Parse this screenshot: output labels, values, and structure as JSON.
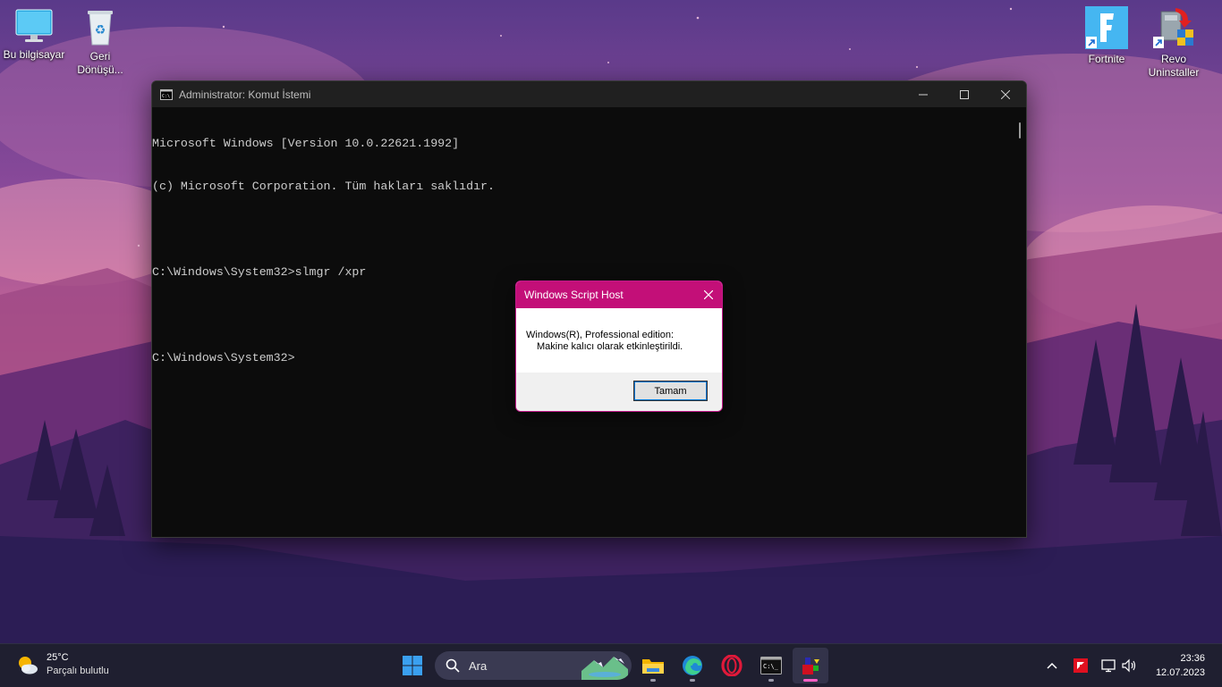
{
  "desktop": {
    "icons": [
      {
        "label": "Bu bilgisayar"
      },
      {
        "label": "Geri Dönüşü..."
      },
      {
        "label": "Fortnite"
      },
      {
        "label": "Revo Uninstaller"
      }
    ]
  },
  "cmd_window": {
    "title": "Administrator: Komut İstemi",
    "lines": [
      "Microsoft Windows [Version 10.0.22621.1992]",
      "(c) Microsoft Corporation. Tüm hakları saklıdır.",
      "",
      "C:\\Windows\\System32>slmgr /xpr",
      "",
      "C:\\Windows\\System32>"
    ],
    "icon": "cmd-icon"
  },
  "dialog": {
    "title": "Windows Script Host",
    "message_line1": "Windows(R), Professional edition:",
    "message_line2": "Makine kalıcı olarak etkinleştirildi.",
    "ok_label": "Tamam",
    "accent_color": "#c30f78"
  },
  "taskbar": {
    "weather": {
      "temperature": "25°C",
      "condition": "Parçalı bulutlu"
    },
    "search_placeholder": "Ara",
    "apps": [
      "start",
      "search",
      "file-explorer",
      "edge",
      "opera",
      "terminal",
      "winrar"
    ],
    "clock": {
      "time": "23:36",
      "date": "12.07.2023"
    }
  }
}
